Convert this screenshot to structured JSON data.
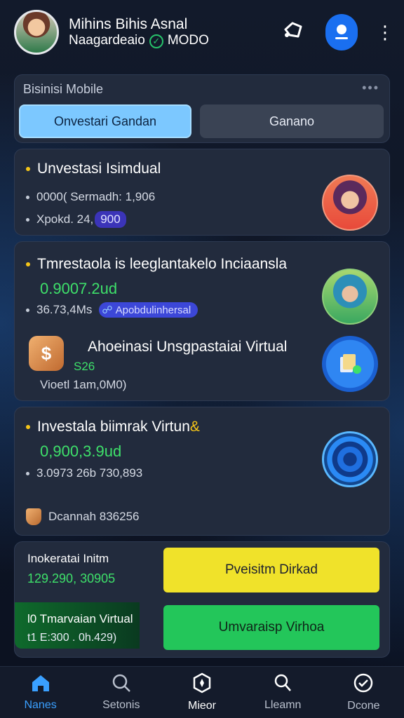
{
  "header": {
    "name": "Mihins Bihis Asnal",
    "subtitle": "Naagardeaio",
    "mode": "MODO"
  },
  "panel_top": {
    "title": "Bisinisi Mobile",
    "tabs": [
      "Onvestari Gandan",
      "Ganano"
    ]
  },
  "card1": {
    "title": "Unvestasi Isimdual",
    "line1": "0000( Sermadh: 1,906",
    "line2_label": "Xpokd. 24,",
    "line2_pill": "900"
  },
  "card2": {
    "title": "Tmrestaola is leeglantakelo Inciaansla",
    "value": "0.9007.2ud",
    "line1": "36.73,4Ms",
    "pill": "Apobdulinhersal",
    "sub_title": "Ahoeinasi Unsgpastaiai Virtual",
    "sub_value": "S26",
    "sub_line": "Vioetl 1am,0M0)"
  },
  "card3": {
    "title": "Investala biimrak Virtun",
    "title_accent": "&",
    "value": "0,900,3.9ud",
    "line1": "3.0973 26b 730,893",
    "footer": "Dcannah 836256"
  },
  "card4": {
    "label1": "Inokeratai Initm",
    "value1": "129.290, 30905",
    "label2": "l0 Tmarvaian Virtual",
    "value2": "t1 E:300 . 0h.429)",
    "button_yellow": "Pveisitm Dirkad",
    "button_green": "Umvaraisp Virhoa"
  },
  "nav": [
    {
      "label": "Nanes",
      "icon": "home-icon"
    },
    {
      "label": "Setonis",
      "icon": "search-icon"
    },
    {
      "label": "Mieor",
      "icon": "compass-icon"
    },
    {
      "label": "Lleamn",
      "icon": "search-icon"
    },
    {
      "label": "Dcone",
      "icon": "check-circle-icon"
    }
  ],
  "colors": {
    "accent": "#3aa0ff",
    "green": "#3ee06a",
    "yellow": "#f0e22a"
  }
}
